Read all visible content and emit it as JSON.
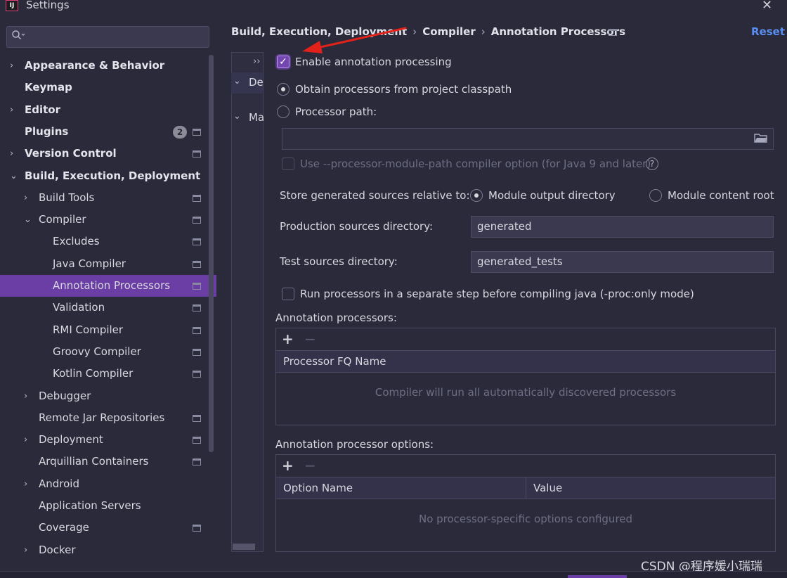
{
  "window": {
    "title": "Settings",
    "app_icon_text": "IJ"
  },
  "search": {
    "placeholder": ""
  },
  "sidebar": {
    "items": [
      {
        "label": "Appearance & Behavior",
        "bold": true,
        "chevron": "›",
        "level": 0
      },
      {
        "label": "Keymap",
        "bold": true,
        "chevron": "",
        "level": 0
      },
      {
        "label": "Editor",
        "bold": true,
        "chevron": "›",
        "level": 0
      },
      {
        "label": "Plugins",
        "bold": true,
        "chevron": "",
        "level": 0,
        "badge": "2",
        "project_icon": true
      },
      {
        "label": "Version Control",
        "bold": true,
        "chevron": "›",
        "level": 0,
        "project_icon": true
      },
      {
        "label": "Build, Execution, Deployment",
        "bold": true,
        "chevron": "⌄",
        "level": 0
      },
      {
        "label": "Build Tools",
        "chevron": "›",
        "level": 1,
        "project_icon": true
      },
      {
        "label": "Compiler",
        "chevron": "⌄",
        "level": 1,
        "project_icon": true
      },
      {
        "label": "Excludes",
        "chevron": "",
        "level": 2,
        "project_icon": true
      },
      {
        "label": "Java Compiler",
        "chevron": "",
        "level": 2,
        "project_icon": true
      },
      {
        "label": "Annotation Processors",
        "chevron": "",
        "level": 2,
        "project_icon": true,
        "selected": true
      },
      {
        "label": "Validation",
        "chevron": "",
        "level": 2,
        "project_icon": true
      },
      {
        "label": "RMI Compiler",
        "chevron": "",
        "level": 2,
        "project_icon": true
      },
      {
        "label": "Groovy Compiler",
        "chevron": "",
        "level": 2,
        "project_icon": true
      },
      {
        "label": "Kotlin Compiler",
        "chevron": "",
        "level": 2,
        "project_icon": true
      },
      {
        "label": "Debugger",
        "chevron": "›",
        "level": 1
      },
      {
        "label": "Remote Jar Repositories",
        "chevron": "",
        "level": 1,
        "project_icon": true
      },
      {
        "label": "Deployment",
        "chevron": "›",
        "level": 1,
        "project_icon": true
      },
      {
        "label": "Arquillian Containers",
        "chevron": "",
        "level": 1,
        "project_icon": true
      },
      {
        "label": "Android",
        "chevron": "›",
        "level": 1
      },
      {
        "label": "Application Servers",
        "chevron": "",
        "level": 1
      },
      {
        "label": "Coverage",
        "chevron": "",
        "level": 1,
        "project_icon": true
      },
      {
        "label": "Docker",
        "chevron": "›",
        "level": 1
      }
    ]
  },
  "breadcrumb": {
    "items": [
      "Build, Execution, Deployment",
      "Compiler",
      "Annotation Processors"
    ],
    "separator": "›",
    "reset_label": "Reset"
  },
  "module_panel": {
    "more": "››",
    "row1_label": "De",
    "row2_label": "Ma"
  },
  "settings": {
    "enable_annotation_processing": {
      "label": "Enable annotation processing",
      "checked": true
    },
    "obtain_from_classpath": {
      "label": "Obtain processors from project classpath",
      "selected": true
    },
    "processor_path": {
      "label": "Processor path:",
      "selected": false,
      "value": ""
    },
    "processor_module_path": {
      "label": "Use --processor-module-path compiler option (for Java 9 and later)",
      "checked": false,
      "disabled": true
    },
    "store_generated": {
      "label": "Store generated sources relative to:",
      "options": [
        "Module output directory",
        "Module content root"
      ],
      "selected": "Module output directory"
    },
    "production_sources": {
      "label": "Production sources directory:",
      "value": "generated"
    },
    "test_sources": {
      "label": "Test sources directory:",
      "value": "generated_tests"
    },
    "separate_step": {
      "label": "Run processors in a separate step before compiling java (-proc:only mode)",
      "checked": false
    }
  },
  "processors_table": {
    "title": "Annotation processors:",
    "add": "+",
    "remove": "−",
    "columns": [
      "Processor FQ Name"
    ],
    "empty_text": "Compiler will run all automatically discovered processors"
  },
  "options_table": {
    "title": "Annotation processor options:",
    "add": "+",
    "remove": "−",
    "columns": [
      "Option Name",
      "Value"
    ],
    "empty_text": "No processor-specific options configured"
  },
  "watermark": "CSDN @程序媛小瑞瑞",
  "colors": {
    "background": "#2b2a3a",
    "selection": "#6a3ea4",
    "link": "#5a8ef0",
    "annotation_arrow": "#e0221a"
  }
}
